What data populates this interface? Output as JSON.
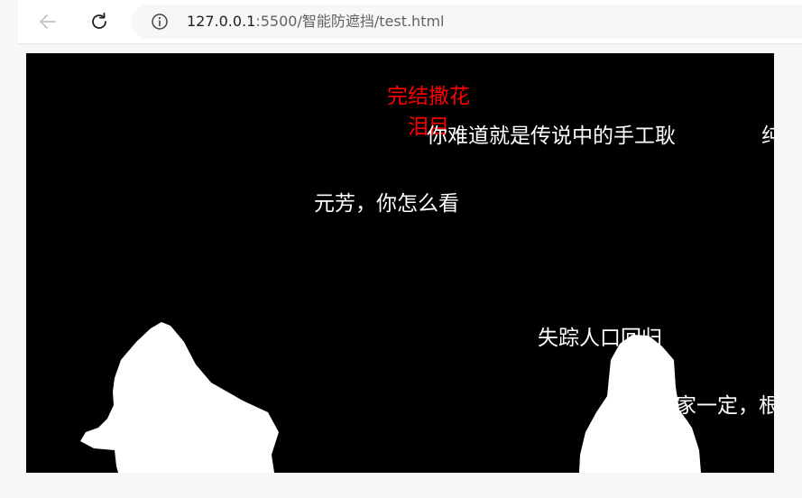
{
  "browser": {
    "url_host": "127.0.0.1",
    "url_path": ":5500/智能防遮挡/test.html",
    "back_icon": "arrow-left-icon",
    "reload_icon": "reload-icon",
    "info_icon": "info-icon"
  },
  "danmaku": [
    {
      "text": "完结撒花泪目",
      "color": "#ff0000"
    },
    {
      "text": "你难道就是传说中的手工耿",
      "color": "#ffffff"
    },
    {
      "text": "纯",
      "color": "#ffffff"
    },
    {
      "text": "元芳，你怎么看",
      "color": "#ffffff"
    },
    {
      "text": "失踪人口回归",
      "color": "#ffffff"
    },
    {
      "text": "家一定，根",
      "color": "#ffffff"
    }
  ],
  "colors": {
    "video_background": "#000000",
    "person_mask": "#ffffff"
  }
}
